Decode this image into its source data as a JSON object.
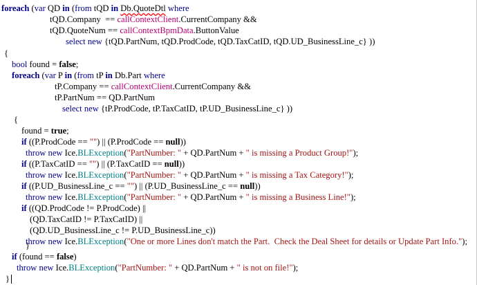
{
  "editor": {
    "lines": [
      [
        [
          "kw",
          "foreach"
        ],
        [
          "id",
          " ("
        ],
        [
          "kw-plain",
          "var"
        ],
        [
          "id",
          " QD "
        ],
        [
          "kw",
          "in"
        ],
        [
          "id",
          " ("
        ],
        [
          "kw-plain",
          "from"
        ],
        [
          "id",
          " tQD "
        ],
        [
          "kw",
          "in"
        ],
        [
          "id",
          " "
        ],
        [
          "err",
          "Db.QuoteDtl"
        ],
        [
          "id",
          " "
        ],
        [
          "kw-plain",
          "where"
        ]
      ],
      [
        [
          "id",
          "tQD.Company  == "
        ],
        [
          "ctx",
          "callContextClient"
        ],
        [
          "id",
          ".CurrentCompany &&"
        ]
      ],
      [
        [
          "id",
          "tQD.QuoteNum == "
        ],
        [
          "ctx",
          "callContextBpmData"
        ],
        [
          "id",
          ".ButtonValue"
        ]
      ],
      [
        [
          "kw-plain",
          "select"
        ],
        [
          "id",
          " "
        ],
        [
          "kw-plain",
          "new"
        ],
        [
          "id",
          " {tQD.PartNum, tQD.ProdCode, tQD.TaxCatID, tQD.UD_BusinessLine_c} ))"
        ]
      ],
      [
        [
          "id",
          "{"
        ]
      ],
      [
        [
          "kw-plain",
          "bool"
        ],
        [
          "id",
          " found = "
        ],
        [
          "lit",
          "false"
        ],
        [
          "id",
          ";"
        ]
      ],
      [
        [
          "kw",
          "foreach"
        ],
        [
          "id",
          " ("
        ],
        [
          "kw-plain",
          "var"
        ],
        [
          "id",
          " P "
        ],
        [
          "kw",
          "in"
        ],
        [
          "id",
          " ("
        ],
        [
          "kw-plain",
          "from"
        ],
        [
          "id",
          " tP "
        ],
        [
          "kw",
          "in"
        ],
        [
          "id",
          " Db.Part "
        ],
        [
          "kw-plain",
          "where"
        ]
      ],
      [
        [
          "id",
          "tP.Company == "
        ],
        [
          "ctx",
          "callContextClient"
        ],
        [
          "id",
          ".CurrentCompany &&"
        ]
      ],
      [
        [
          "id",
          "tP.PartNum == QD.PartNum"
        ]
      ],
      [
        [
          "kw-plain",
          "select"
        ],
        [
          "id",
          " "
        ],
        [
          "kw-plain",
          "new"
        ],
        [
          "id",
          " {tP.ProdCode, tP.TaxCatID, tP.UD_BusinessLine_c} ))"
        ]
      ],
      [
        [
          "id",
          "{"
        ]
      ],
      [
        [
          "id",
          "found = "
        ],
        [
          "lit",
          "true"
        ],
        [
          "id",
          ";"
        ]
      ],
      [
        [
          "kw",
          "if"
        ],
        [
          "id",
          " ((P.ProdCode == "
        ],
        [
          "str",
          "\"\""
        ],
        [
          "id",
          ") || (P.ProdCode == "
        ],
        [
          "lit",
          "null"
        ],
        [
          "id",
          "))"
        ]
      ],
      [
        [
          "kw-plain",
          "throw"
        ],
        [
          "id",
          " "
        ],
        [
          "kw-plain",
          "new"
        ],
        [
          "id",
          " Ice."
        ],
        [
          "type",
          "BLException"
        ],
        [
          "id",
          "("
        ],
        [
          "str",
          "\"PartNumber: \""
        ],
        [
          "id",
          " + QD.PartNum + "
        ],
        [
          "str",
          "\" is missing a Product Group!\""
        ],
        [
          "id",
          ");"
        ]
      ],
      [
        [
          "kw",
          "if"
        ],
        [
          "id",
          " ((P.TaxCatID == "
        ],
        [
          "str",
          "\"\""
        ],
        [
          "id",
          ") || (P.TaxCatID == "
        ],
        [
          "lit",
          "null"
        ],
        [
          "id",
          "))"
        ]
      ],
      [
        [
          "kw-plain",
          "throw"
        ],
        [
          "id",
          " "
        ],
        [
          "kw-plain",
          "new"
        ],
        [
          "id",
          " Ice."
        ],
        [
          "type",
          "BLException"
        ],
        [
          "id",
          "("
        ],
        [
          "str",
          "\"PartNumber: \""
        ],
        [
          "id",
          " + QD.PartNum + "
        ],
        [
          "str",
          "\" is missing a Tax Category!\""
        ],
        [
          "id",
          ");"
        ]
      ],
      [
        [
          "kw",
          "if"
        ],
        [
          "id",
          " ((P.UD_BusinessLine_c == "
        ],
        [
          "str",
          "\"\""
        ],
        [
          "id",
          ") || (P.UD_BusinessLine_c == "
        ],
        [
          "lit",
          "null"
        ],
        [
          "id",
          "))"
        ]
      ],
      [
        [
          "kw-plain",
          "throw"
        ],
        [
          "id",
          " "
        ],
        [
          "kw-plain",
          "new"
        ],
        [
          "id",
          " Ice."
        ],
        [
          "type",
          "BLException"
        ],
        [
          "id",
          "("
        ],
        [
          "str",
          "\"PartNumber: \""
        ],
        [
          "id",
          " + QD.PartNum + "
        ],
        [
          "str",
          "\" is missing a Business Line!\""
        ],
        [
          "id",
          ");"
        ]
      ],
      [
        [
          "kw",
          "if"
        ],
        [
          "id",
          " ((QD.ProdCode != P.ProdCode) ||"
        ]
      ],
      [
        [
          "id",
          "(QD.TaxCatID != P.TaxCatID) ||"
        ]
      ],
      [
        [
          "id",
          "(QD.UD_BusinessLine_c != P.UD_BusinessLine_c))"
        ]
      ],
      [
        [
          "kw-plain",
          "throw"
        ],
        [
          "id",
          " "
        ],
        [
          "kw-plain",
          "new"
        ],
        [
          "id",
          " Ice."
        ],
        [
          "type",
          "BLException"
        ],
        [
          "id",
          "("
        ],
        [
          "str",
          "\"One or more Lines don't match the Part.  Check the Deal Sheet for details or Update Part Info.\""
        ],
        [
          "id",
          ");"
        ]
      ],
      [
        [
          "id",
          "}"
        ]
      ],
      [
        [
          "kw",
          "if"
        ],
        [
          "id",
          " (found == "
        ],
        [
          "lit",
          "false"
        ],
        [
          "id",
          ")"
        ]
      ],
      [
        [
          "kw-plain",
          "throw"
        ],
        [
          "id",
          " "
        ],
        [
          "kw-plain",
          "new"
        ],
        [
          "id",
          " Ice."
        ],
        [
          "type",
          "BLException"
        ],
        [
          "id",
          "("
        ],
        [
          "str",
          "\"PartNumber: \""
        ],
        [
          "id",
          " + QD.PartNum + "
        ],
        [
          "str",
          "\" is not on file!\""
        ],
        [
          "id",
          ");"
        ]
      ],
      [
        [
          "id",
          "}"
        ]
      ]
    ]
  }
}
